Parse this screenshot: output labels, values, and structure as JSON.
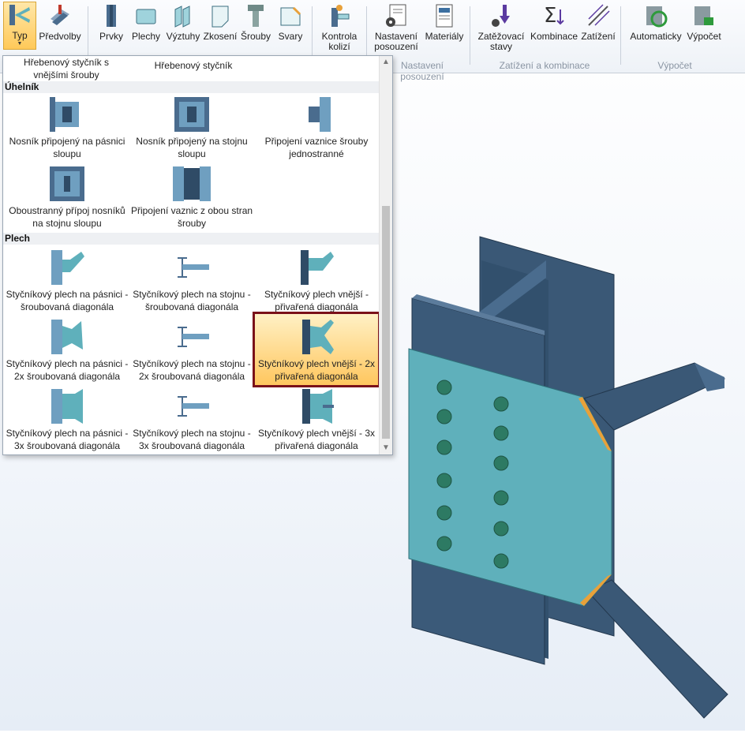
{
  "ribbon": {
    "buttons": [
      {
        "label": "Typ",
        "icon": "type-icon",
        "active": true,
        "has_dropdown": true
      },
      {
        "label": "Předvolby",
        "icon": "presets-icon"
      },
      {
        "label": "Prvky",
        "icon": "members-icon"
      },
      {
        "label": "Plechy",
        "icon": "plates-icon"
      },
      {
        "label": "Výztuhy",
        "icon": "stiffeners-icon"
      },
      {
        "label": "Zkosení",
        "icon": "chamfer-icon"
      },
      {
        "label": "Šrouby",
        "icon": "bolt-icon"
      },
      {
        "label": "Svary",
        "icon": "weld-icon"
      },
      {
        "label": "Kontrola kolizí",
        "icon": "collision-check-icon"
      },
      {
        "label": "Nastavení posouzení",
        "icon": "check-settings-icon"
      },
      {
        "label": "Materiály",
        "icon": "materials-icon"
      },
      {
        "label": "Zatěžovací stavy",
        "icon": "load-cases-icon"
      },
      {
        "label": "Kombinace",
        "icon": "combination-icon"
      },
      {
        "label": "Zatížení",
        "icon": "loads-icon"
      },
      {
        "label": "Automaticky",
        "icon": "auto-calc-icon"
      },
      {
        "label": "Výpočet",
        "icon": "calculate-icon"
      }
    ],
    "groups": {
      "check": "Nastavení posouzení",
      "loads": "Zatížení a kombinace",
      "calc": "Výpočet"
    }
  },
  "dropdown": {
    "top_items": [
      "Hřebenový styčník s vnějšími šrouby",
      "Hřebenový styčník"
    ],
    "sections": [
      {
        "title": "Úhelník",
        "items": [
          "Nosník připojený na pásnici sloupu",
          "Nosník připojený na stojnu sloupu",
          "Připojení vaznice šrouby jednostranné",
          "Oboustranný přípoj nosníků na stojnu sloupu",
          "Připojení vaznic z obou stran šrouby"
        ]
      },
      {
        "title": "Plech",
        "items": [
          "Styčníkový plech na pásnici - šroubovaná diagonála",
          "Styčníkový plech na stojnu - šroubovaná diagonála",
          "Styčníkový plech vnější - přivařená diagonála",
          "Styčníkový plech na pásnici - 2x šroubovaná diagonála",
          "Styčníkový plech na stojnu - 2x šroubovaná diagonála",
          "Styčníkový plech vnější - 2x přivařená diagonála",
          "Styčníkový plech na pásnici - 3x šroubovaná diagonála",
          "Styčníkový plech na stojnu - 3x šroubovaná diagonála",
          "Styčníkový plech vnější - 3x přivařená diagonála"
        ]
      }
    ],
    "selected": "Styčníkový plech vnější - 2x přivařená diagonála"
  },
  "colors": {
    "steel_dark": "#3c5a78",
    "steel_mid": "#4a6c8e",
    "plate": "#5fb0bb",
    "bolt": "#2d7a63",
    "weld": "#e8a13a",
    "selection_border": "#7a1119"
  }
}
